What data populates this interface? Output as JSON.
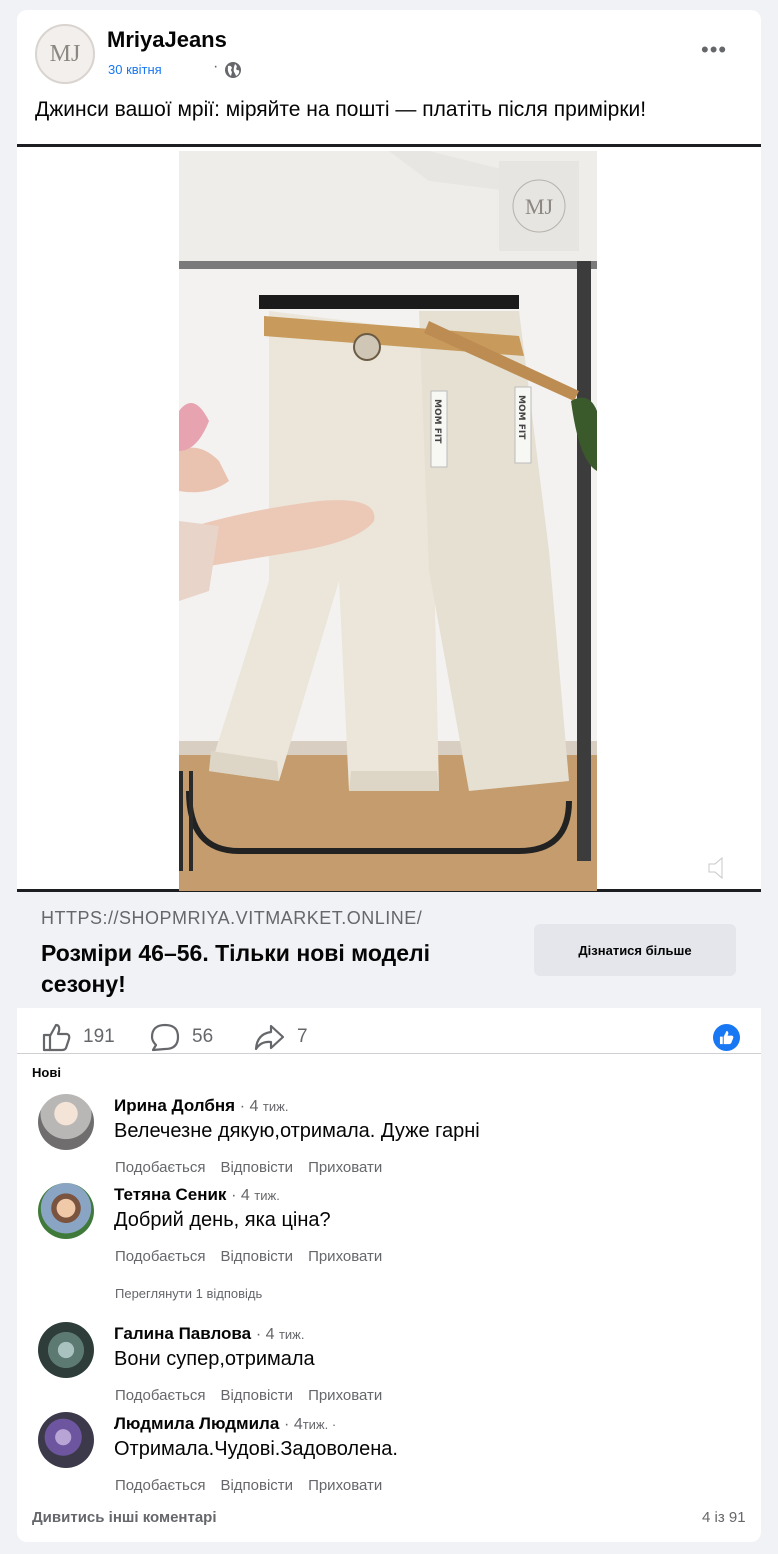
{
  "post": {
    "page_name": "MriyaJeans",
    "logo_letters": "MJ",
    "date": "30 квітня",
    "dot": "·",
    "text": "Джинси вашої мрії: міряйте на пошті — платіть після примірки!"
  },
  "video": {
    "watermark": "MJ",
    "tag_left": "MOM FIT",
    "tag_right": "MOM FIT"
  },
  "link": {
    "url": "HTTPS://SHOPMRIYA.VITMARKET.ONLINE/",
    "headline": "Розміри 46–56. Тільки нові моделі сезону!",
    "cta": "Дізнатися більше"
  },
  "stats": {
    "likes": "191",
    "comments": "56",
    "shares": "7"
  },
  "comments_section": {
    "sort_label": "Нові",
    "action_like": "Подобається",
    "action_reply": "Відповісти",
    "action_hide": "Приховати",
    "view_replies": "Переглянути 1 відповідь",
    "more_comments": "Дивитись інші коментарі",
    "pager": "4 із 91",
    "items": [
      {
        "name": "Ирина Долбня",
        "time_num": "· 4",
        "time_unit": "тиж.",
        "text": "Велечезне дякую,отримала. Дуже гарні"
      },
      {
        "name": "Тетяна Сеник",
        "time_num": "· 4",
        "time_unit": "тиж.",
        "text": "Добрий день, яка ціна?"
      },
      {
        "name": "Галина Павлова",
        "time_num": "· 4",
        "time_unit": "тиж.",
        "text": "Вони супер,отримала"
      },
      {
        "name": "Людмила Людмила",
        "time_num": "· 4",
        "time_unit": "тиж. ·",
        "text": "Отримала.Чудові.Задоволена."
      }
    ]
  }
}
